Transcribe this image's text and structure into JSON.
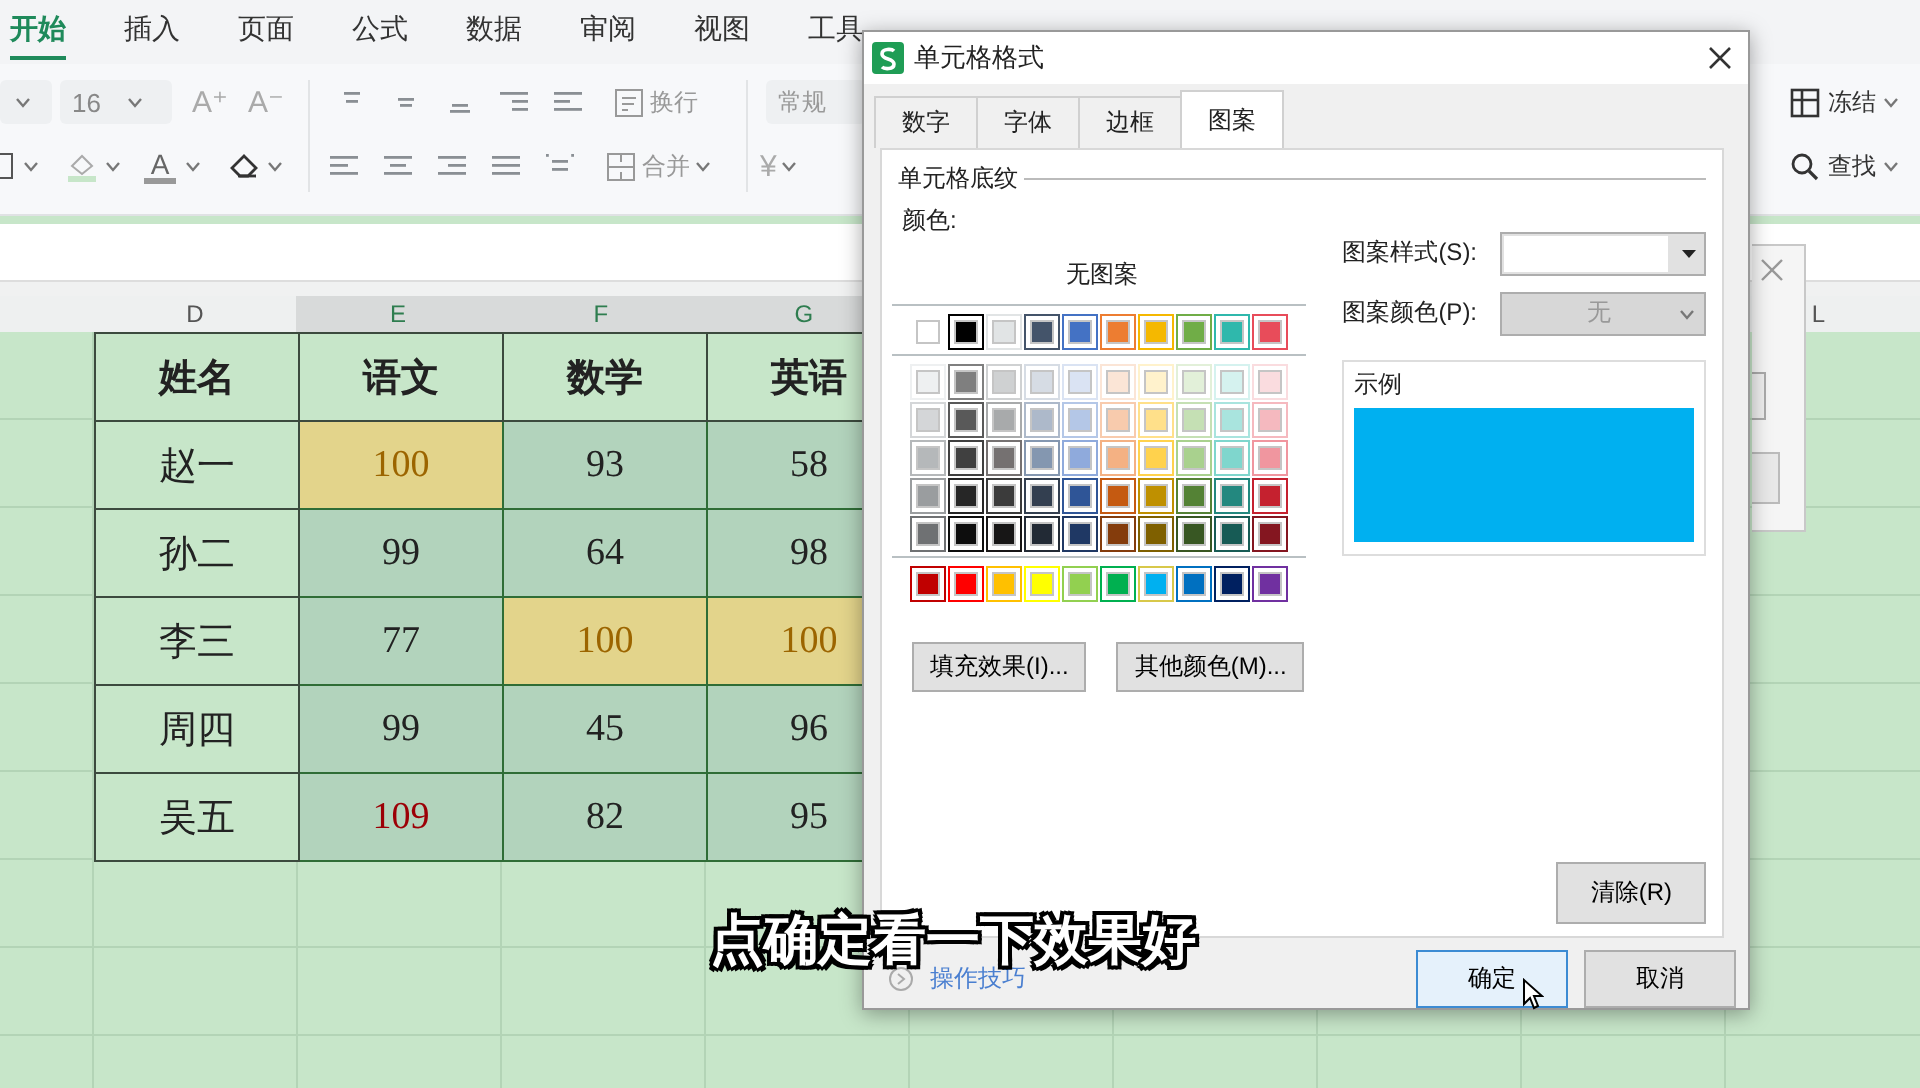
{
  "menu_tabs": [
    {
      "label": "开始",
      "selected": true
    },
    {
      "label": "插入",
      "selected": false
    },
    {
      "label": "页面",
      "selected": false
    },
    {
      "label": "公式",
      "selected": false
    },
    {
      "label": "数据",
      "selected": false
    },
    {
      "label": "审阅",
      "selected": false
    },
    {
      "label": "视图",
      "selected": false
    },
    {
      "label": "工具",
      "selected": false
    }
  ],
  "ribbon": {
    "font_size": "16",
    "grow_font": "A⁺",
    "shrink_font": "A⁻",
    "font_color": "A",
    "wrap": "换行",
    "merge": "合并",
    "number_format": "常规",
    "currency": "¥",
    "freeze": "冻结",
    "find": "查找"
  },
  "columns": [
    {
      "letter": "D",
      "selected": false
    },
    {
      "letter": "E",
      "selected": true
    },
    {
      "letter": "F",
      "selected": true
    },
    {
      "letter": "G",
      "selected": true
    }
  ],
  "far_column": "L",
  "table": {
    "header": [
      "姓名",
      "语文",
      "数学",
      "英语"
    ],
    "rows": [
      {
        "name": "赵一",
        "scores": [
          {
            "text": "100",
            "kind": "good",
            "selected": true
          },
          {
            "text": "93",
            "kind": "plain",
            "selected": true
          },
          {
            "text": "58",
            "kind": "plain",
            "selected": true
          }
        ]
      },
      {
        "name": "孙二",
        "scores": [
          {
            "text": "99",
            "kind": "plain",
            "selected": true
          },
          {
            "text": "64",
            "kind": "plain",
            "selected": true
          },
          {
            "text": "98",
            "kind": "plain",
            "selected": true
          }
        ]
      },
      {
        "name": "李三",
        "scores": [
          {
            "text": "77",
            "kind": "plain",
            "selected": true
          },
          {
            "text": "100",
            "kind": "good",
            "selected": true
          },
          {
            "text": "100",
            "kind": "good",
            "selected": true
          }
        ]
      },
      {
        "name": "周四",
        "scores": [
          {
            "text": "99",
            "kind": "plain",
            "selected": true
          },
          {
            "text": "45",
            "kind": "plain",
            "selected": true
          },
          {
            "text": "96",
            "kind": "plain",
            "selected": true
          }
        ]
      },
      {
        "name": "吴五",
        "scores": [
          {
            "text": "109",
            "kind": "bad",
            "selected": true
          },
          {
            "text": "82",
            "kind": "plain",
            "selected": true
          },
          {
            "text": "95",
            "kind": "plain",
            "selected": true
          }
        ]
      }
    ]
  },
  "dialog": {
    "title": "单元格格式",
    "tabs": [
      {
        "label": "数字",
        "selected": false
      },
      {
        "label": "字体",
        "selected": false
      },
      {
        "label": "边框",
        "selected": false
      },
      {
        "label": "图案",
        "selected": true
      }
    ],
    "group_title": "单元格底纹",
    "color_label": "颜色:",
    "no_pattern": "无图案",
    "swatch_groups": [
      [
        [
          {
            "color": "#ffffff",
            "selected": false
          },
          {
            "color": "#000000",
            "selected": false
          },
          {
            "color": "#e1e4e5",
            "selected": false
          },
          {
            "color": "#44546a",
            "selected": false
          },
          {
            "color": "#4472c4",
            "selected": false
          },
          {
            "color": "#ed7d31",
            "selected": false
          },
          {
            "color": "#f5b800",
            "selected": false
          },
          {
            "color": "#70ad47",
            "selected": false
          },
          {
            "color": "#2fb8ac",
            "selected": false
          },
          {
            "color": "#e84c5a",
            "selected": false
          }
        ]
      ],
      [
        [
          {
            "color": "#eef0f1",
            "selected": false
          },
          {
            "color": "#7f7f7f",
            "selected": false
          },
          {
            "color": "#cfd1d2",
            "selected": false
          },
          {
            "color": "#d6dce4",
            "selected": false
          },
          {
            "color": "#dae3f3",
            "selected": false
          },
          {
            "color": "#fbe5d6",
            "selected": false
          },
          {
            "color": "#fff2cc",
            "selected": false
          },
          {
            "color": "#e2f0d9",
            "selected": false
          },
          {
            "color": "#d5f2ef",
            "selected": false
          },
          {
            "color": "#fadcdf",
            "selected": false
          }
        ],
        [
          {
            "color": "#d4d6d8",
            "selected": false
          },
          {
            "color": "#595959",
            "selected": false
          },
          {
            "color": "#a8aaab",
            "selected": false
          },
          {
            "color": "#adb9ca",
            "selected": false
          },
          {
            "color": "#b4c7e7",
            "selected": false
          },
          {
            "color": "#f8cbad",
            "selected": false
          },
          {
            "color": "#ffe08a",
            "selected": false
          },
          {
            "color": "#c5e0b4",
            "selected": false
          },
          {
            "color": "#a9e4de",
            "selected": false
          },
          {
            "color": "#f5b9bf",
            "selected": false
          }
        ],
        [
          {
            "color": "#b5b8ba",
            "selected": false
          },
          {
            "color": "#404040",
            "selected": false
          },
          {
            "color": "#757171",
            "selected": false
          },
          {
            "color": "#8497b0",
            "selected": false
          },
          {
            "color": "#8faadc",
            "selected": false
          },
          {
            "color": "#f4b183",
            "selected": false
          },
          {
            "color": "#ffd24d",
            "selected": false
          },
          {
            "color": "#a9d18e",
            "selected": false
          },
          {
            "color": "#7fd6cd",
            "selected": false
          },
          {
            "color": "#f0969f",
            "selected": false
          }
        ],
        [
          {
            "color": "#9a9d9f",
            "selected": false
          },
          {
            "color": "#262626",
            "selected": false
          },
          {
            "color": "#3b3b3b",
            "selected": false
          },
          {
            "color": "#333f50",
            "selected": false
          },
          {
            "color": "#2f5597",
            "selected": false
          },
          {
            "color": "#c55a11",
            "selected": false
          },
          {
            "color": "#bf9000",
            "selected": false
          },
          {
            "color": "#548235",
            "selected": false
          },
          {
            "color": "#23887f",
            "selected": false
          },
          {
            "color": "#c5212f",
            "selected": false
          }
        ],
        [
          {
            "color": "#6f7173",
            "selected": false
          },
          {
            "color": "#0d0d0d",
            "selected": false
          },
          {
            "color": "#171616",
            "selected": false
          },
          {
            "color": "#222a35",
            "selected": false
          },
          {
            "color": "#1f3864",
            "selected": false
          },
          {
            "color": "#843c0c",
            "selected": false
          },
          {
            "color": "#7f6000",
            "selected": false
          },
          {
            "color": "#385723",
            "selected": false
          },
          {
            "color": "#175b55",
            "selected": false
          },
          {
            "color": "#841620",
            "selected": false
          }
        ]
      ],
      [
        [
          {
            "color": "#c00000",
            "selected": false
          },
          {
            "color": "#ff0000",
            "selected": false
          },
          {
            "color": "#ffc000",
            "selected": false
          },
          {
            "color": "#ffff00",
            "selected": false
          },
          {
            "color": "#92d050",
            "selected": false
          },
          {
            "color": "#00b050",
            "selected": false
          },
          {
            "color": "#00b0f0",
            "selected": true
          },
          {
            "color": "#0070c0",
            "selected": false
          },
          {
            "color": "#002060",
            "selected": false
          },
          {
            "color": "#7030a0",
            "selected": false
          }
        ]
      ]
    ],
    "fill_effects_button": "填充效果(I)...",
    "more_colors_button": "其他颜色(M)...",
    "pattern_style_label": "图案样式(S):",
    "pattern_color_label": "图案颜色(P):",
    "pattern_color": {
      "value": "无",
      "disabled": true
    },
    "sample_label": "示例",
    "clear_button": "清除(R)",
    "tips_link": "操作技巧",
    "ok_button": {
      "label": "确定",
      "focused": true
    },
    "cancel_button": "取消"
  },
  "subtitle": "点确定看一下效果好"
}
